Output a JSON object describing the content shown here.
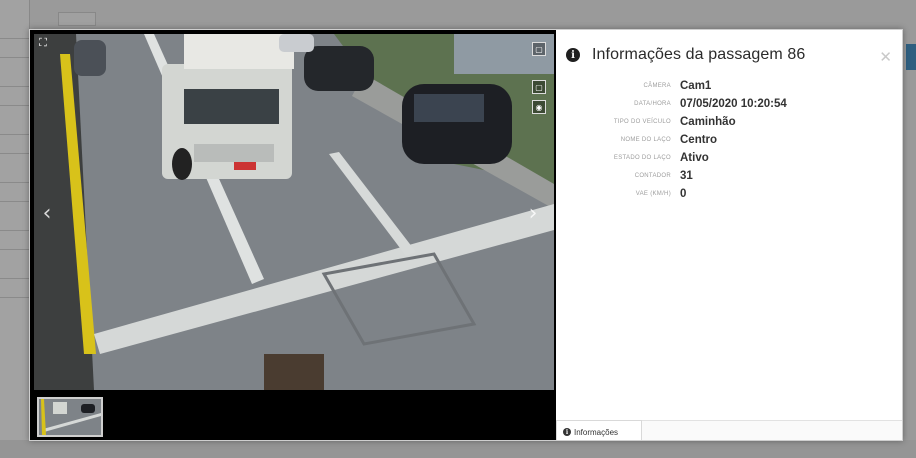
{
  "info_panel": {
    "title": "Informações da passagem 86",
    "info_icon_glyph": "i",
    "close_glyph": "✕",
    "properties": [
      {
        "label": "CÂMERA",
        "value": "Cam1"
      },
      {
        "label": "DATA/HORA",
        "value": "07/05/2020 10:20:54"
      },
      {
        "label": "TIPO DO VEÍCULO",
        "value": "Caminhão"
      },
      {
        "label": "NOME DO LAÇO",
        "value": "Centro"
      },
      {
        "label": "ESTADO DO LAÇO",
        "value": "Ativo"
      },
      {
        "label": "CONTADOR",
        "value": "31"
      },
      {
        "label": "VAE (KM/H)",
        "value": "0"
      }
    ],
    "tab_label": "Informações"
  },
  "viewer": {
    "fullscreen_glyph": "⛶",
    "prev_glyph": "‹",
    "next_glyph": "›",
    "side_buttons": [
      "▢",
      "▢",
      "◉"
    ]
  },
  "icons": {
    "info": "info-circle-icon",
    "close": "close-icon",
    "fullscreen": "fullscreen-icon",
    "prev": "chevron-left-icon",
    "next": "chevron-right-icon"
  },
  "colors": {
    "title_text": "#2b2b2b",
    "label_text": "#9d9d9d",
    "value_text": "#333333",
    "viewer_bg": "#000000",
    "road_line_yellow": "#d8c21a",
    "accent_blue": "#2f5f80"
  }
}
